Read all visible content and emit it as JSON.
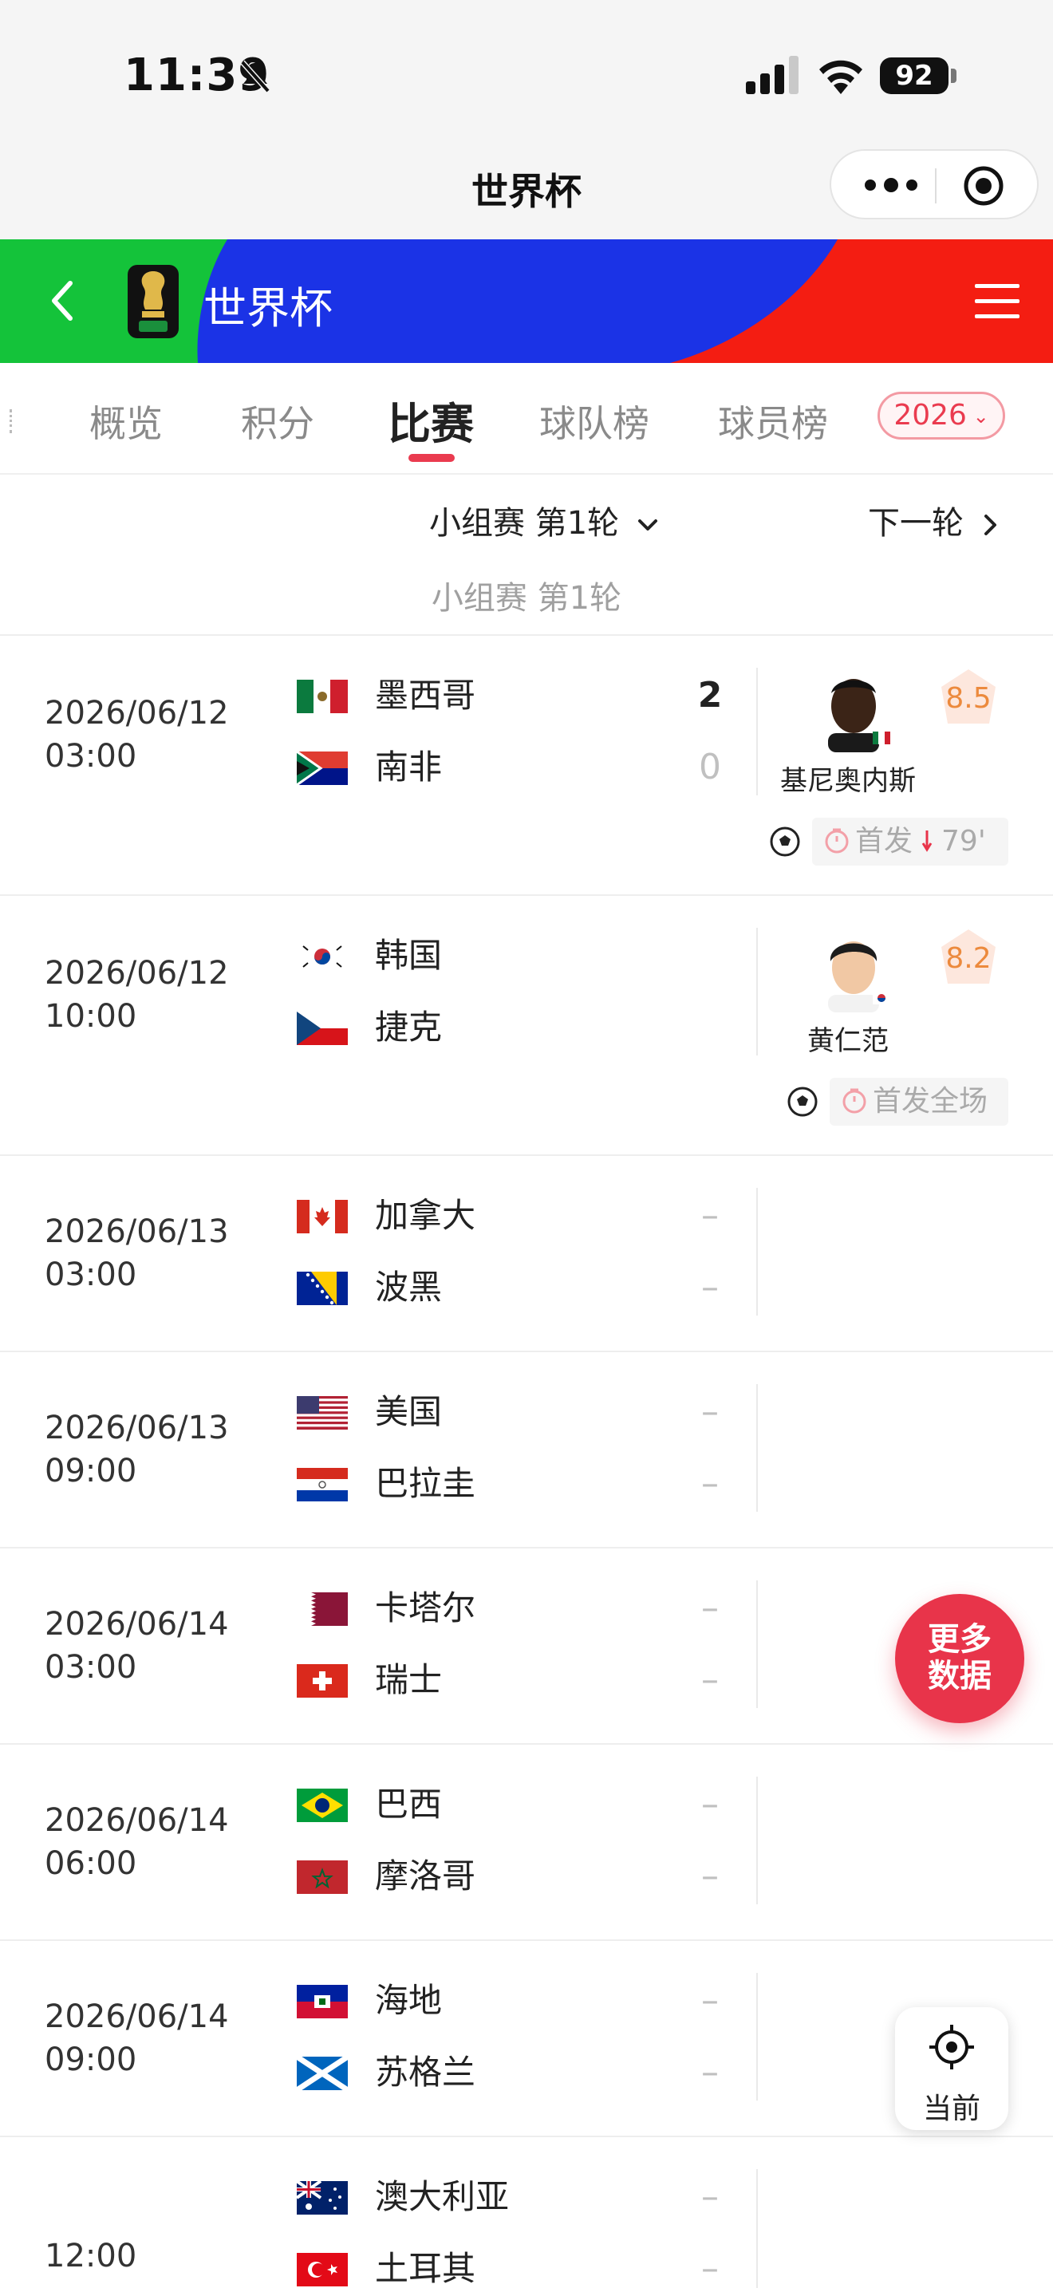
{
  "status_bar": {
    "time": "11:39",
    "battery": "92",
    "icons": [
      "bell-muted-icon",
      "signal-icon",
      "wifi-icon",
      "battery-icon"
    ]
  },
  "title_bar": {
    "title": "世界杯",
    "icons": [
      "more-dots-icon",
      "target-icon"
    ]
  },
  "banner": {
    "title": "世界杯",
    "colors": {
      "left": "#14c33a",
      "middle": "#1b33e6",
      "right": "#f41d12"
    }
  },
  "tabs": {
    "items": [
      "概览",
      "积分",
      "比赛",
      "球队榜",
      "球员榜"
    ],
    "active": "比赛",
    "year": "2026"
  },
  "round": {
    "selected": "小组赛 第1轮",
    "next": "下一轮",
    "subtitle": "小组赛 第1轮"
  },
  "matches": [
    {
      "date": "2026/06/12",
      "time": "03:00",
      "home": "墨西哥",
      "away": "南非",
      "home_score": "2",
      "away_score": "0",
      "player": {
        "name": "基尼奥内斯",
        "rating": "8.5",
        "tag": "首发",
        "sub_time": "79'"
      }
    },
    {
      "date": "2026/06/12",
      "time": "10:00",
      "home": "韩国",
      "away": "捷克",
      "home_score": "",
      "away_score": "",
      "player": {
        "name": "黄仁范",
        "rating": "8.2",
        "tag": "首发全场"
      }
    },
    {
      "date": "2026/06/13",
      "time": "03:00",
      "home": "加拿大",
      "away": "波黑",
      "home_score": "–",
      "away_score": "–"
    },
    {
      "date": "2026/06/13",
      "time": "09:00",
      "home": "美国",
      "away": "巴拉圭",
      "home_score": "–",
      "away_score": "–"
    },
    {
      "date": "2026/06/14",
      "time": "03:00",
      "home": "卡塔尔",
      "away": "瑞士",
      "home_score": "–",
      "away_score": "–"
    },
    {
      "date": "2026/06/14",
      "time": "06:00",
      "home": "巴西",
      "away": "摩洛哥",
      "home_score": "–",
      "away_score": "–"
    },
    {
      "date": "2026/06/14",
      "time": "09:00",
      "home": "海地",
      "away": "苏格兰",
      "home_score": "–",
      "away_score": "–"
    },
    {
      "date": "",
      "time": "12:00",
      "home": "澳大利亚",
      "away": "土耳其",
      "home_score": "–",
      "away_score": "–"
    }
  ],
  "floating": {
    "more_data_line1": "更多",
    "more_data_line2": "数据",
    "current": "当前"
  },
  "colors": {
    "accent": "#ea3b4f",
    "rating": "#ec8a3d"
  }
}
